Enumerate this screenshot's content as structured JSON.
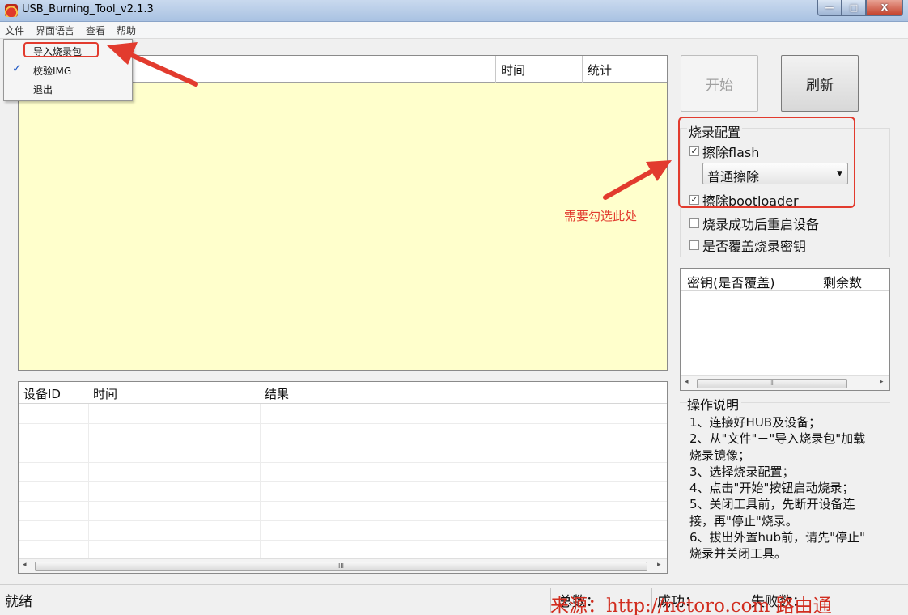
{
  "window": {
    "title": "USB_Burning_Tool_v2.1.3",
    "controls": {
      "minimize": "—",
      "maximize": "□",
      "close": "X"
    }
  },
  "menubar": {
    "items": [
      "文件",
      "界面语言",
      "查看",
      "帮助"
    ]
  },
  "file_menu": {
    "items": [
      {
        "label": "导入烧录包",
        "checked": false
      },
      {
        "label": "校验IMG",
        "checked": true
      },
      {
        "label": "退出",
        "checked": false
      }
    ]
  },
  "device_table": {
    "columns": [
      "时间",
      "统计"
    ]
  },
  "actions": {
    "start": "开始",
    "refresh": "刷新"
  },
  "burn_config": {
    "title": "烧录配置",
    "erase_flash": {
      "label": "擦除flash",
      "checked": true
    },
    "erase_mode": {
      "value": "普通擦除"
    },
    "erase_bootloader": {
      "label": "擦除bootloader",
      "checked": true
    },
    "reboot_after": {
      "label": "烧录成功后重启设备",
      "checked": false
    },
    "overwrite_key": {
      "label": "是否覆盖烧录密钥",
      "checked": false
    }
  },
  "key_table": {
    "columns": [
      "密钥(是否覆盖)",
      "剩余数"
    ]
  },
  "result_table": {
    "columns": [
      "设备ID",
      "时间",
      "结果"
    ]
  },
  "instructions": {
    "title": "操作说明",
    "lines": [
      "1、连接好HUB及设备；",
      "2、从\"文件\"－\"导入烧录包\"加载",
      "烧录镜像；",
      "3、选择烧录配置；",
      "4、点击\"开始\"按钮启动烧录；",
      "5、关闭工具前，先断开设备连",
      "接，再\"停止\"烧录。",
      "6、拔出外置hub前，请先\"停止\"",
      "烧录并关闭工具。"
    ]
  },
  "statusbar": {
    "status": "就绪",
    "total_label": "总数：",
    "success_label": "成功：",
    "failed_label": "失败数："
  },
  "annotation": {
    "note": "需要勾选此处",
    "color": "#e23b2e"
  },
  "watermark": "来源：http://nctoro.com 路由通",
  "scrollbar": {
    "thumb_glyph": "III",
    "left": "◂",
    "right": "▸"
  }
}
